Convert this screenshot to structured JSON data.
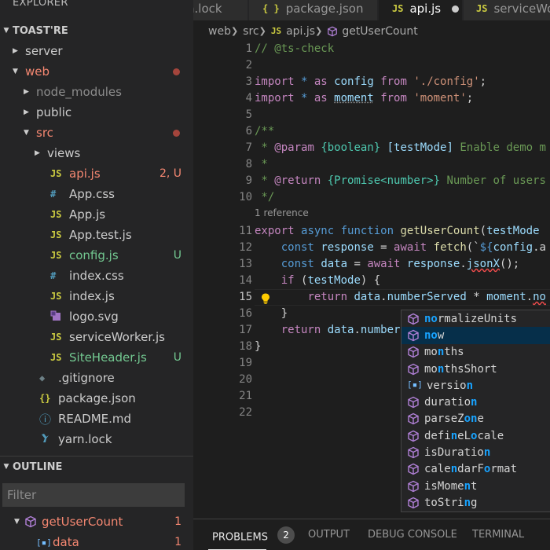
{
  "explorer": {
    "title": "EXPLORER",
    "project": "TOAST'RE",
    "tree": [
      {
        "label": "server",
        "depth": 0,
        "type": "folder",
        "open": false,
        "color": "plain"
      },
      {
        "label": "web",
        "depth": 0,
        "type": "folder",
        "open": true,
        "color": "red",
        "dot": true
      },
      {
        "label": "node_modules",
        "depth": 1,
        "type": "folder",
        "open": false,
        "color": "dim"
      },
      {
        "label": "public",
        "depth": 1,
        "type": "folder",
        "open": false,
        "color": "plain"
      },
      {
        "label": "src",
        "depth": 1,
        "type": "folder",
        "open": true,
        "color": "red",
        "dot": true
      },
      {
        "label": "views",
        "depth": 2,
        "type": "folder",
        "open": false,
        "color": "plain"
      },
      {
        "label": "api.js",
        "depth": 2,
        "type": "file",
        "icon": "js",
        "color": "red",
        "badge": "2, U"
      },
      {
        "label": "App.css",
        "depth": 2,
        "type": "file",
        "icon": "css",
        "color": "plain"
      },
      {
        "label": "App.js",
        "depth": 2,
        "type": "file",
        "icon": "js",
        "color": "plain"
      },
      {
        "label": "App.test.js",
        "depth": 2,
        "type": "file",
        "icon": "js",
        "color": "plain"
      },
      {
        "label": "config.js",
        "depth": 2,
        "type": "file",
        "icon": "js",
        "color": "green",
        "badge": "U"
      },
      {
        "label": "index.css",
        "depth": 2,
        "type": "file",
        "icon": "css",
        "color": "plain"
      },
      {
        "label": "index.js",
        "depth": 2,
        "type": "file",
        "icon": "js",
        "color": "plain"
      },
      {
        "label": "logo.svg",
        "depth": 2,
        "type": "file",
        "icon": "svg",
        "color": "plain"
      },
      {
        "label": "serviceWorker.js",
        "depth": 2,
        "type": "file",
        "icon": "js",
        "color": "plain"
      },
      {
        "label": "SiteHeader.js",
        "depth": 2,
        "type": "file",
        "icon": "js",
        "color": "green",
        "badge": "U"
      },
      {
        "label": ".gitignore",
        "depth": 1,
        "type": "file",
        "icon": "git",
        "color": "plain"
      },
      {
        "label": "package.json",
        "depth": 1,
        "type": "file",
        "icon": "json",
        "color": "plain"
      },
      {
        "label": "README.md",
        "depth": 1,
        "type": "file",
        "icon": "info",
        "color": "plain"
      },
      {
        "label": "yarn.lock",
        "depth": 1,
        "type": "file",
        "icon": "yarn",
        "color": "plain"
      }
    ]
  },
  "outline": {
    "title": "OUTLINE",
    "filter_placeholder": "Filter",
    "items": [
      {
        "label": "getUserCount",
        "badge": "1",
        "kind": "function"
      },
      {
        "label": "data",
        "badge": "1",
        "kind": "variable"
      }
    ]
  },
  "tabs": [
    {
      "label": "n.lock",
      "icon": "",
      "active": false
    },
    {
      "label": "package.json",
      "icon": "{ }",
      "active": false
    },
    {
      "label": "api.js",
      "icon": "JS",
      "active": true,
      "modified": true
    },
    {
      "label": "serviceWo",
      "icon": "JS",
      "active": false
    }
  ],
  "breadcrumb": {
    "parts": [
      "web",
      "src",
      "api.js",
      "getUserCount"
    ],
    "file_icon": "JS"
  },
  "editor": {
    "line_numbers": [
      "1",
      "2",
      "3",
      "4",
      "5",
      "6",
      "7",
      "8",
      "9",
      "10",
      "11",
      "12",
      "13",
      "14",
      "15",
      "16",
      "17",
      "18",
      "19",
      "20",
      "21",
      "22"
    ],
    "current_line": "15",
    "codelens": "1 reference",
    "lines": [
      [
        [
          "// @ts-check",
          "cm"
        ]
      ],
      [],
      [
        [
          "import",
          "kw"
        ],
        [
          " * ",
          "bl"
        ],
        [
          "as",
          "kw"
        ],
        [
          " ",
          "pl"
        ],
        [
          "config",
          "var"
        ],
        [
          " ",
          "pl"
        ],
        [
          "from",
          "kw"
        ],
        [
          " ",
          "pl"
        ],
        [
          "'./config'",
          "str"
        ],
        [
          ";",
          "pl"
        ]
      ],
      [
        [
          "import",
          "kw"
        ],
        [
          " * ",
          "bl"
        ],
        [
          "as",
          "kw"
        ],
        [
          " ",
          "pl"
        ],
        [
          "moment",
          "var"
        ],
        [
          " ",
          "pl"
        ],
        [
          "from",
          "kw"
        ],
        [
          " ",
          "pl"
        ],
        [
          "'moment'",
          "str"
        ],
        [
          ";",
          "pl"
        ]
      ],
      [],
      [
        [
          "/**",
          "cm"
        ]
      ],
      [
        [
          " * ",
          "cm"
        ],
        [
          "@param",
          "kw"
        ],
        [
          " ",
          "cm"
        ],
        [
          "{boolean}",
          "ty"
        ],
        [
          " ",
          "cm"
        ],
        [
          "[testMode]",
          "var"
        ],
        [
          " Enable demo m",
          "cm"
        ]
      ],
      [
        [
          " *",
          "cm"
        ]
      ],
      [
        [
          " * ",
          "cm"
        ],
        [
          "@return",
          "kw"
        ],
        [
          " ",
          "cm"
        ],
        [
          "{Promise<number>}",
          "ty"
        ],
        [
          " Number of users",
          "cm"
        ]
      ],
      [
        [
          " */",
          "cm"
        ]
      ],
      [
        [
          "export",
          "kw"
        ],
        [
          " ",
          "pl"
        ],
        [
          "async",
          "bl"
        ],
        [
          " ",
          "pl"
        ],
        [
          "function",
          "bl"
        ],
        [
          " ",
          "pl"
        ],
        [
          "getUserCount",
          "fn"
        ],
        [
          "(",
          "pl"
        ],
        [
          "testMode",
          "var"
        ],
        [
          " ",
          "pl"
        ]
      ],
      [
        [
          "    ",
          "pl"
        ],
        [
          "const",
          "bl"
        ],
        [
          " ",
          "pl"
        ],
        [
          "response",
          "var"
        ],
        [
          " = ",
          "pl"
        ],
        [
          "await",
          "kw"
        ],
        [
          " ",
          "pl"
        ],
        [
          "fetch",
          "fn"
        ],
        [
          "(`",
          "pl"
        ],
        [
          "${",
          "bl"
        ],
        [
          "config",
          "var"
        ],
        [
          ".a",
          "pl"
        ]
      ],
      [
        [
          "    ",
          "pl"
        ],
        [
          "const",
          "bl"
        ],
        [
          " ",
          "pl"
        ],
        [
          "data",
          "var"
        ],
        [
          " = ",
          "pl"
        ],
        [
          "await",
          "kw"
        ],
        [
          " ",
          "pl"
        ],
        [
          "response",
          "var"
        ],
        [
          ".",
          "pl"
        ],
        [
          "jsonX",
          "sq"
        ],
        [
          "();",
          "pl"
        ]
      ],
      [
        [
          "    ",
          "pl"
        ],
        [
          "if",
          "kw"
        ],
        [
          " (",
          "pl"
        ],
        [
          "testMode",
          "var"
        ],
        [
          ") {",
          "pl"
        ]
      ],
      [
        [
          "        ",
          "pl"
        ],
        [
          "return",
          "kw"
        ],
        [
          " ",
          "pl"
        ],
        [
          "data",
          "var"
        ],
        [
          ".",
          "pl"
        ],
        [
          "numberServed",
          "var"
        ],
        [
          " * ",
          "pl"
        ],
        [
          "moment",
          "var"
        ],
        [
          ".",
          "pl"
        ],
        [
          "no",
          "sq"
        ]
      ],
      [
        [
          "    }",
          "pl"
        ]
      ],
      [
        [
          "    ",
          "pl"
        ],
        [
          "return",
          "kw"
        ],
        [
          " ",
          "pl"
        ],
        [
          "data",
          "var"
        ],
        [
          ".",
          "pl"
        ],
        [
          "number",
          "var"
        ]
      ],
      [
        [
          "}",
          "pl"
        ]
      ],
      [],
      [],
      [],
      []
    ]
  },
  "suggestions": [
    {
      "before": "",
      "match": "no",
      "after": "rmalizeUnits",
      "kind": "method",
      "selected": false
    },
    {
      "before": "",
      "match": "no",
      "after": "w",
      "kind": "method",
      "selected": true
    },
    {
      "before": "mo",
      "match": "n",
      "after": "ths",
      "kind": "method",
      "selected": false
    },
    {
      "before": "mo",
      "match": "n",
      "after": "thsShort",
      "kind": "method",
      "selected": false
    },
    {
      "before": "versio",
      "match": "n",
      "after": "",
      "kind": "property",
      "selected": false
    },
    {
      "before": "duratio",
      "match": "n",
      "after": "",
      "kind": "method",
      "selected": false
    },
    {
      "before": "parseZ",
      "match": "on",
      "after": "e",
      "kind": "method",
      "selected": false
    },
    {
      "before": "defi",
      "match": "n",
      "after": "eL",
      "kind": "method",
      "selected": false,
      "match2": "o",
      "after2": "cale"
    },
    {
      "before": "isDuratio",
      "match": "n",
      "after": "",
      "kind": "method",
      "selected": false
    },
    {
      "before": "cale",
      "match": "n",
      "after": "darF",
      "kind": "method",
      "selected": false,
      "match2": "o",
      "after2": "rmat"
    },
    {
      "before": "isMome",
      "match": "n",
      "after": "t",
      "kind": "method",
      "selected": false
    },
    {
      "before": "toStri",
      "match": "n",
      "after": "g",
      "kind": "method",
      "selected": false
    }
  ],
  "panel": {
    "tabs": [
      "PROBLEMS",
      "OUTPUT",
      "DEBUG CONSOLE",
      "TERMINAL"
    ],
    "problems_count": "2"
  },
  "colors": {
    "accent": "#18a3ff",
    "modified_red": "#f48771",
    "untracked_green": "#73c991",
    "selection": "#062f4a"
  }
}
